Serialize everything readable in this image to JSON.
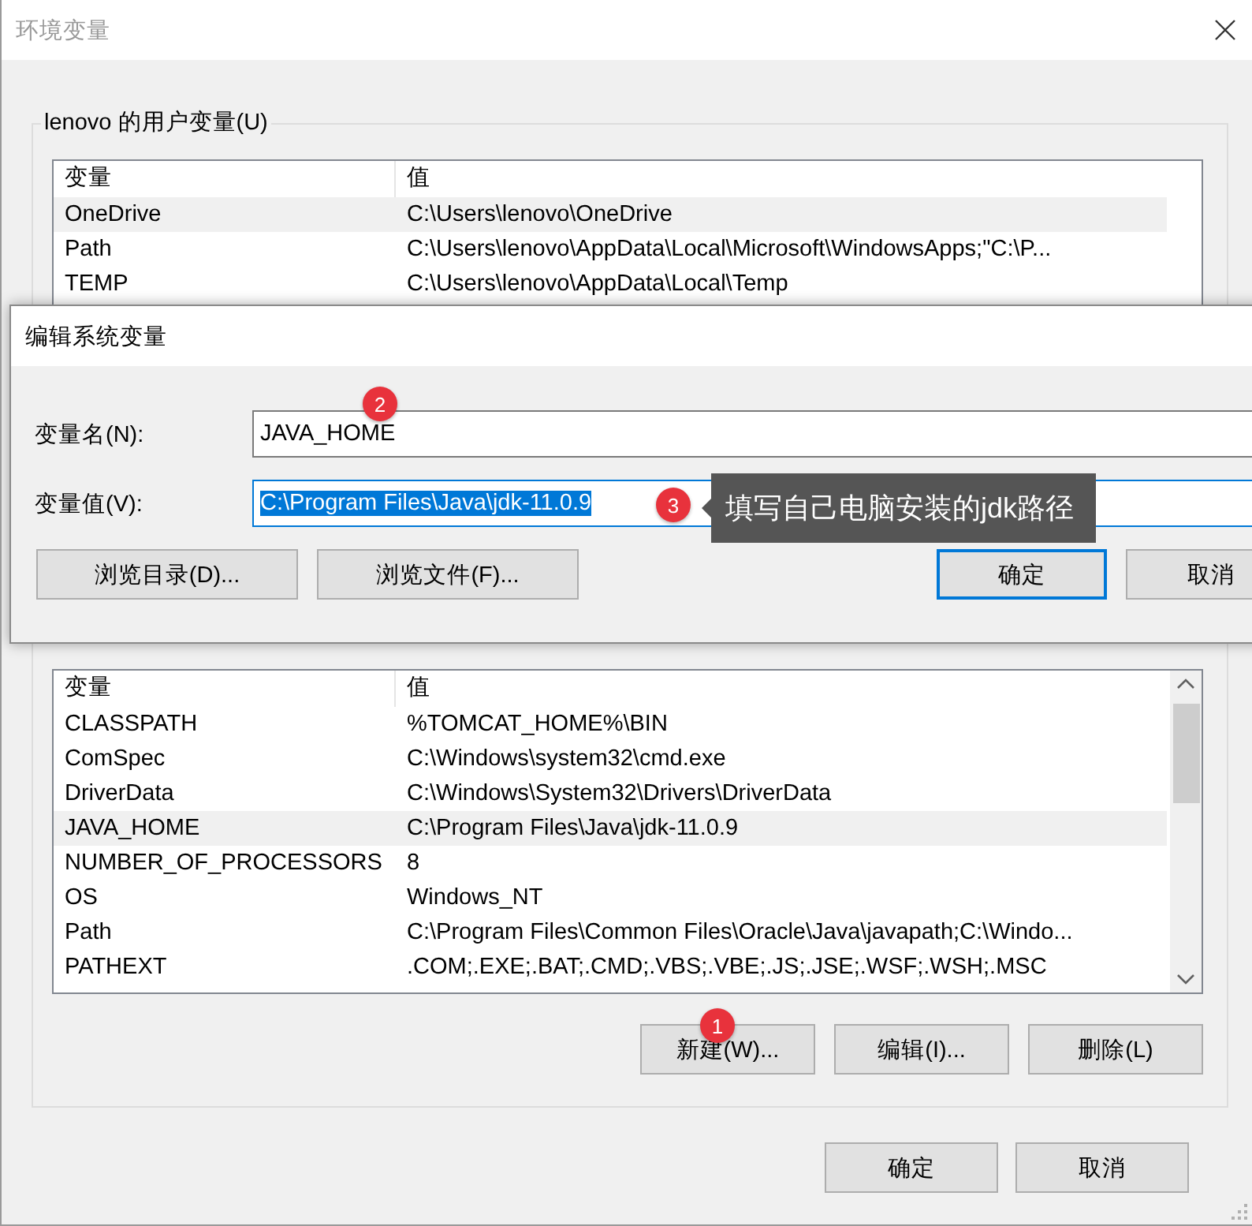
{
  "window": {
    "title": "环境变量"
  },
  "user_vars": {
    "title": "lenovo 的用户变量(U)",
    "columns": [
      "变量",
      "值"
    ],
    "rows": [
      {
        "name": "OneDrive",
        "value": "C:\\Users\\lenovo\\OneDrive",
        "selected": true
      },
      {
        "name": "Path",
        "value": "C:\\Users\\lenovo\\AppData\\Local\\Microsoft\\WindowsApps;\"C:\\P...",
        "selected": false
      },
      {
        "name": "TEMP",
        "value": "C:\\Users\\lenovo\\AppData\\Local\\Temp",
        "selected": false
      }
    ]
  },
  "edit_dialog": {
    "title": "编辑系统变量",
    "fields": [
      {
        "label": "变量名(N):",
        "value": "JAVA_HOME",
        "text_selected": false,
        "focused": false
      },
      {
        "label": "变量值(V):",
        "value": "C:\\Program Files\\Java\\jdk-11.0.9",
        "text_selected": true,
        "focused": true
      }
    ],
    "buttons": [
      {
        "label": "浏览目录(D)...",
        "default": false
      },
      {
        "label": "浏览文件(F)...",
        "default": false
      },
      {
        "label": "确定",
        "default": true
      },
      {
        "label": "取消",
        "default": false
      }
    ]
  },
  "system_vars": {
    "columns": [
      "变量",
      "值"
    ],
    "rows": [
      {
        "name": "CLASSPATH",
        "value": "%TOMCAT_HOME%\\BIN",
        "selected": false
      },
      {
        "name": "ComSpec",
        "value": "C:\\Windows\\system32\\cmd.exe",
        "selected": false
      },
      {
        "name": "DriverData",
        "value": "C:\\Windows\\System32\\Drivers\\DriverData",
        "selected": false
      },
      {
        "name": "JAVA_HOME",
        "value": "C:\\Program Files\\Java\\jdk-11.0.9",
        "selected": true
      },
      {
        "name": "NUMBER_OF_PROCESSORS",
        "value": "8",
        "selected": false
      },
      {
        "name": "OS",
        "value": "Windows_NT",
        "selected": false
      },
      {
        "name": "Path",
        "value": "C:\\Program Files\\Common Files\\Oracle\\Java\\javapath;C:\\Windo...",
        "selected": false
      },
      {
        "name": "PATHEXT",
        "value": ".COM;.EXE;.BAT;.CMD;.VBS;.VBE;.JS;.JSE;.WSF;.WSH;.MSC",
        "selected": false
      }
    ],
    "buttons": [
      "新建(W)...",
      "编辑(I)...",
      "删除(L)"
    ]
  },
  "buttons": [
    "确定",
    "取消"
  ],
  "annotations": [
    {
      "number": "1"
    },
    {
      "number": "2"
    },
    {
      "number": "3",
      "note": "填写自己电脑安装的jdk路径"
    }
  ]
}
